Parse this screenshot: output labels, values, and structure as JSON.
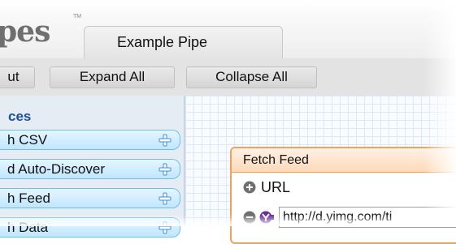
{
  "header": {
    "logo_text": "pes",
    "tm": "TM",
    "tab_label": "Example Pipe"
  },
  "toolbar": {
    "buttons": [
      {
        "label": "ut"
      },
      {
        "label": "Expand All"
      },
      {
        "label": "Collapse All"
      }
    ]
  },
  "sources": {
    "title": "ces",
    "modules": [
      {
        "label": "h CSV"
      },
      {
        "label": "d Auto-Discover"
      },
      {
        "label": "h Feed"
      },
      {
        "label": "h Data"
      }
    ]
  },
  "feed_module": {
    "title": "Fetch Feed",
    "field_label": "URL",
    "url_value": "http://d.yimg.com/ti"
  },
  "colors": {
    "module_border": "#6ebfe9",
    "feed_border": "#f2a15a",
    "link_title": "#1b4fa0"
  },
  "icons": {
    "module_add": "plus-icon",
    "field_expand": "circle-plus-icon",
    "field_remove": "circle-minus-icon",
    "input_source": "yahoo-y-icon"
  }
}
